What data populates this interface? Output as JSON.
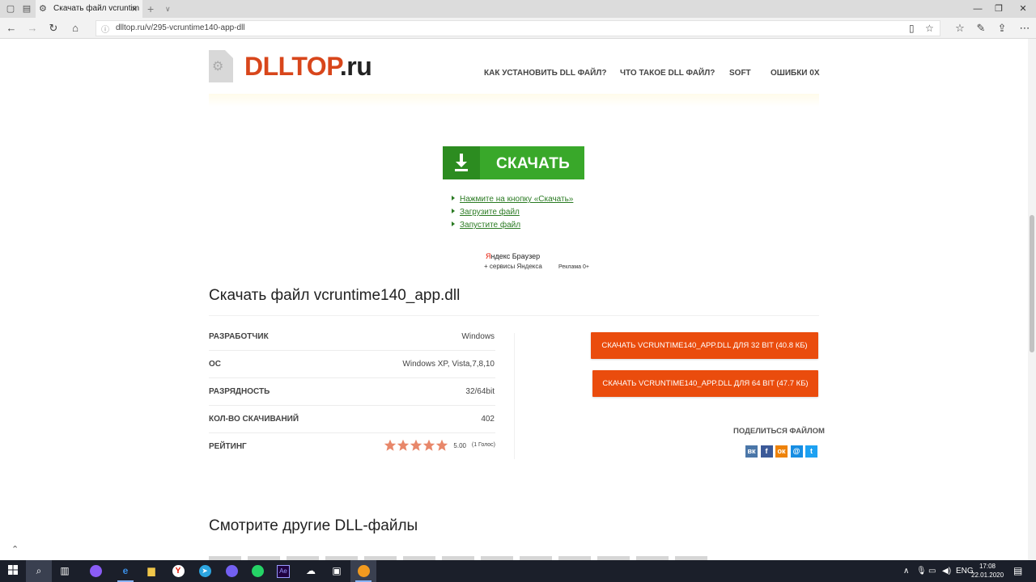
{
  "browser": {
    "tab_title": "Скачать файл vcruntim",
    "url": "dlltop.ru/v/295-vcruntime140-app-dll"
  },
  "site": {
    "logo_part1": "DLLTOP",
    "logo_part2": ".ru",
    "nav": [
      "КАК УСТАНОВИТЬ DLL ФАЙЛ?",
      "ЧТО ТАКОЕ DLL ФАЙЛ?",
      "SOFT",
      "ОШИБКИ 0X"
    ]
  },
  "download": {
    "button_label": "СКАЧАТЬ",
    "steps": [
      "Нажмите на кнопку «Скачать»",
      "Загрузите файл",
      "Запустите файл"
    ]
  },
  "ad": {
    "line1_y": "Я",
    "line1_rest": "ндекс Браузер",
    "line2": "+ сервисы Яндекса",
    "label": "Реклама 0+"
  },
  "file": {
    "heading": "Скачать файл vcruntime140_app.dll",
    "rows": [
      {
        "key": "РАЗРАБОТЧИК",
        "value": "Windows"
      },
      {
        "key": "ОС",
        "value": "Windows XP, Vista,7,8,10"
      },
      {
        "key": "РАЗРЯДНОСТЬ",
        "value": "32/64bit"
      },
      {
        "key": "КОЛ-ВО СКАЧИВАНИЙ",
        "value": "402"
      },
      {
        "key": "РЕЙТИНГ",
        "value": ""
      }
    ],
    "rating": {
      "stars_filled": 5,
      "stars_total": 5,
      "score": "5.00",
      "votes": "(1 Голос)",
      "color": "#e8876a"
    },
    "btn32": "СКАЧАТЬ VCRUNTIME140_APP.DLL ДЛЯ 32 BIT (40.8 КБ)",
    "btn64": "СКАЧАТЬ VCRUNTIME140_APP.DLL ДЛЯ 64 BIT (47.7 КБ)",
    "share_label": "ПОДЕЛИТЬСЯ ФАЙЛОМ",
    "social": [
      {
        "name": "vk",
        "glyph": "вк",
        "color": "#4a76a8"
      },
      {
        "name": "facebook",
        "glyph": "f",
        "color": "#3b5998"
      },
      {
        "name": "odnoklassniki",
        "glyph": "ок",
        "color": "#ee8208"
      },
      {
        "name": "moimir",
        "glyph": "@",
        "color": "#168de2"
      },
      {
        "name": "twitter",
        "glyph": "t",
        "color": "#1da1f2"
      }
    ]
  },
  "other_heading": "Смотрите другие DLL-файлы",
  "taskbar": {
    "lang": "ENG",
    "time": "17:08",
    "date": "22.01.2020"
  },
  "colors": {
    "accent_orange": "#ea4c0d",
    "accent_green": "#39a82a",
    "logo_orange": "#d8461b"
  }
}
